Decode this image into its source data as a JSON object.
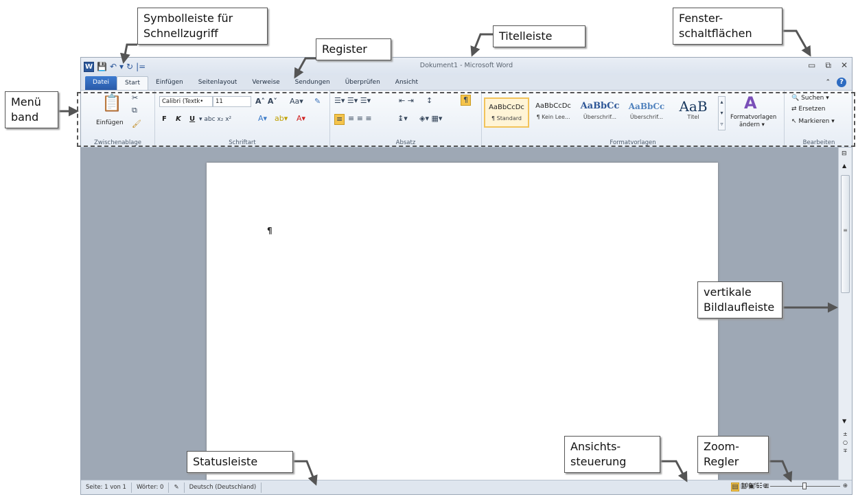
{
  "window": {
    "title": "Dokument1 - Microsoft Word",
    "controls": [
      "▭",
      "⧉",
      "✕"
    ]
  },
  "qat": {
    "logo": "W",
    "items": [
      "💾",
      "↶",
      "▾",
      "↻",
      "|="
    ]
  },
  "tabs": [
    "Datei",
    "Start",
    "Einfügen",
    "Seitenlayout",
    "Verweise",
    "Sendungen",
    "Überprüfen",
    "Ansicht"
  ],
  "ribbon": {
    "clipboard": {
      "label": "Zwischenablage",
      "paste": "Einfügen"
    },
    "font": {
      "label": "Schriftart",
      "name": "Calibri (Textk•",
      "size": "11",
      "bold": "F",
      "italic": "K",
      "underline": "U"
    },
    "paragraph": {
      "label": "Absatz"
    },
    "styles": {
      "label": "Formatvorlagen",
      "items": [
        {
          "preview": "AaBbCcDc",
          "name": "¶ Standard"
        },
        {
          "preview": "AaBbCcDc",
          "name": "¶ Kein Lee..."
        },
        {
          "preview": "AaBbCc",
          "name": "Überschrif..."
        },
        {
          "preview": "AaBbCc",
          "name": "Überschrif..."
        },
        {
          "preview": "AaB",
          "name": "Titel"
        }
      ],
      "change_line1": "Formatvorlagen",
      "change_line2": "ändern ▾"
    },
    "editing": {
      "label": "Bearbeiten",
      "find": "Suchen ▾",
      "replace": "Ersetzen",
      "select": "Markieren ▾"
    }
  },
  "document": {
    "mark": "¶"
  },
  "status": {
    "page": "Seite: 1 von 1",
    "words": "Wörter: 0",
    "language": "Deutsch (Deutschland)",
    "zoom": "100 %"
  },
  "callouts": {
    "qat_l1": "Symbolleiste für",
    "qat_l2": "Schnellzugriff",
    "register": "Register",
    "titlebar": "Titelleiste",
    "window_l1": "Fenster-",
    "window_l2": "schaltflächen",
    "ribbon_l1": "Menü",
    "ribbon_l2": "band",
    "scroll_l1": "vertikale",
    "scroll_l2": "Bildlaufleiste",
    "view_l1": "Ansichts-",
    "view_l2": "steuerung",
    "zoom_l1": "Zoom-",
    "zoom_l2": "Regler",
    "status": "Statusleiste"
  }
}
